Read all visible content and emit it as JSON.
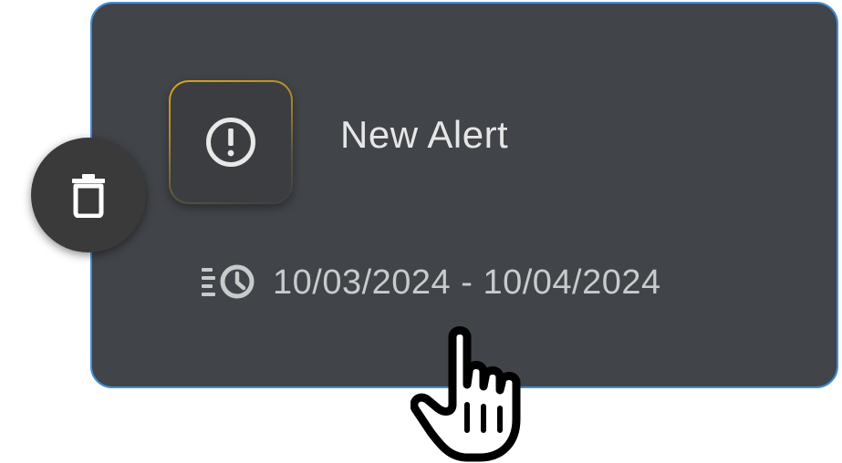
{
  "alert": {
    "title": "New Alert",
    "date_range": "10/03/2024 - 10/04/2024",
    "icon": "exclamation-circle-icon",
    "date_icon": "schedule-list-clock-icon"
  },
  "actions": {
    "delete_icon": "trash-icon"
  },
  "pointer": {
    "icon": "hand-pointer-cursor-icon"
  },
  "colors": {
    "card_background": "#414448",
    "card_border": "#3f8ed8",
    "icon_tile_accent": "#d9a41c",
    "delete_button_background": "#3a3a3a",
    "text_primary": "#e6e6e6",
    "text_secondary": "#c9cacc"
  }
}
